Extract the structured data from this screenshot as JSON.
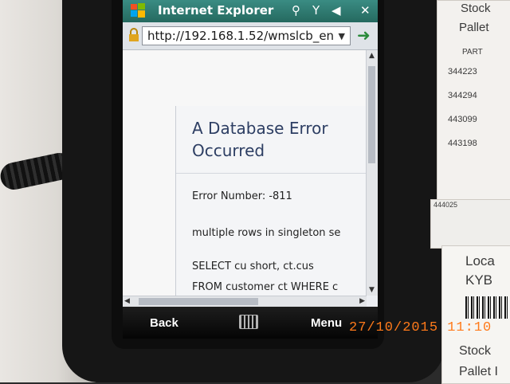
{
  "browser": {
    "title": "Internet Explorer",
    "address": "http://192.168.1.52/wmslcb_en"
  },
  "error": {
    "title_line1": "A Database Error",
    "title_line2": "Occurred",
    "number": "Error Number: -811",
    "message": "multiple rows in singleton se",
    "sql_line1": "SELECT cu      short, ct.cus",
    "sql_line2": "FROM customer ct WHERE c"
  },
  "softkeys": {
    "back": "Back",
    "menu": "Menu"
  },
  "photo": {
    "timestamp": "27/10/2015 11:10",
    "paper_top_lines": [
      "Stock",
      "Pallet"
    ],
    "paper_part_header": "PART",
    "paper_parts": [
      "344223",
      "344294",
      "443099",
      "443198"
    ],
    "paper_mid_code": "444025",
    "paper_bottom_lines": [
      "Loca",
      "KYB",
      "Stock",
      "Pallet I"
    ]
  },
  "icons": [
    "windows-logo-icon",
    "signal-icon",
    "network-off-icon",
    "volume-mute-icon",
    "close-icon",
    "lock-icon",
    "go-arrow-icon",
    "keyboard-icon"
  ],
  "colors": {
    "titlebar": "#2e7a70",
    "error_title": "#2d3e63",
    "timestamp": "#ff7a1a"
  }
}
